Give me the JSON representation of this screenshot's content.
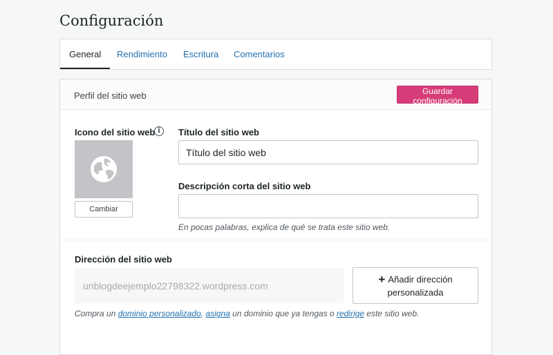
{
  "page": {
    "title": "Configuración"
  },
  "tabs": [
    {
      "label": "General",
      "active": true
    },
    {
      "label": "Rendimiento",
      "active": false
    },
    {
      "label": "Escritura",
      "active": false
    },
    {
      "label": "Comentarios",
      "active": false
    }
  ],
  "card": {
    "header": "Perfil del sitio web",
    "save_label": "Guardar configuración",
    "site_icon": {
      "label": "Icono del sitio web",
      "info": "i",
      "change_label": "Cambiar",
      "icon": "globe-icon"
    },
    "site_title": {
      "label": "Título del sitio web",
      "value": "Título del sitio web"
    },
    "tagline": {
      "label": "Descripción corta del sitio web",
      "value": "",
      "hint": "En pocas palabras, explica de qué se trata este sitio web."
    },
    "address": {
      "label": "Dirección del sitio web",
      "value": "unblogdeejemplo22798322.wordpress.com",
      "add_label_1": "Añadir dirección",
      "add_label_2": "personalizada",
      "hint_parts": {
        "p1": "Compra un ",
        "link1": "dominio personalizado",
        "p2": ", ",
        "link2": "asigna",
        "p3": " un dominio que ya tengas o ",
        "link3": "redirige",
        "p4": " este sitio web."
      }
    }
  },
  "colors": {
    "accent": "#d63c78",
    "link": "#2271b1"
  }
}
